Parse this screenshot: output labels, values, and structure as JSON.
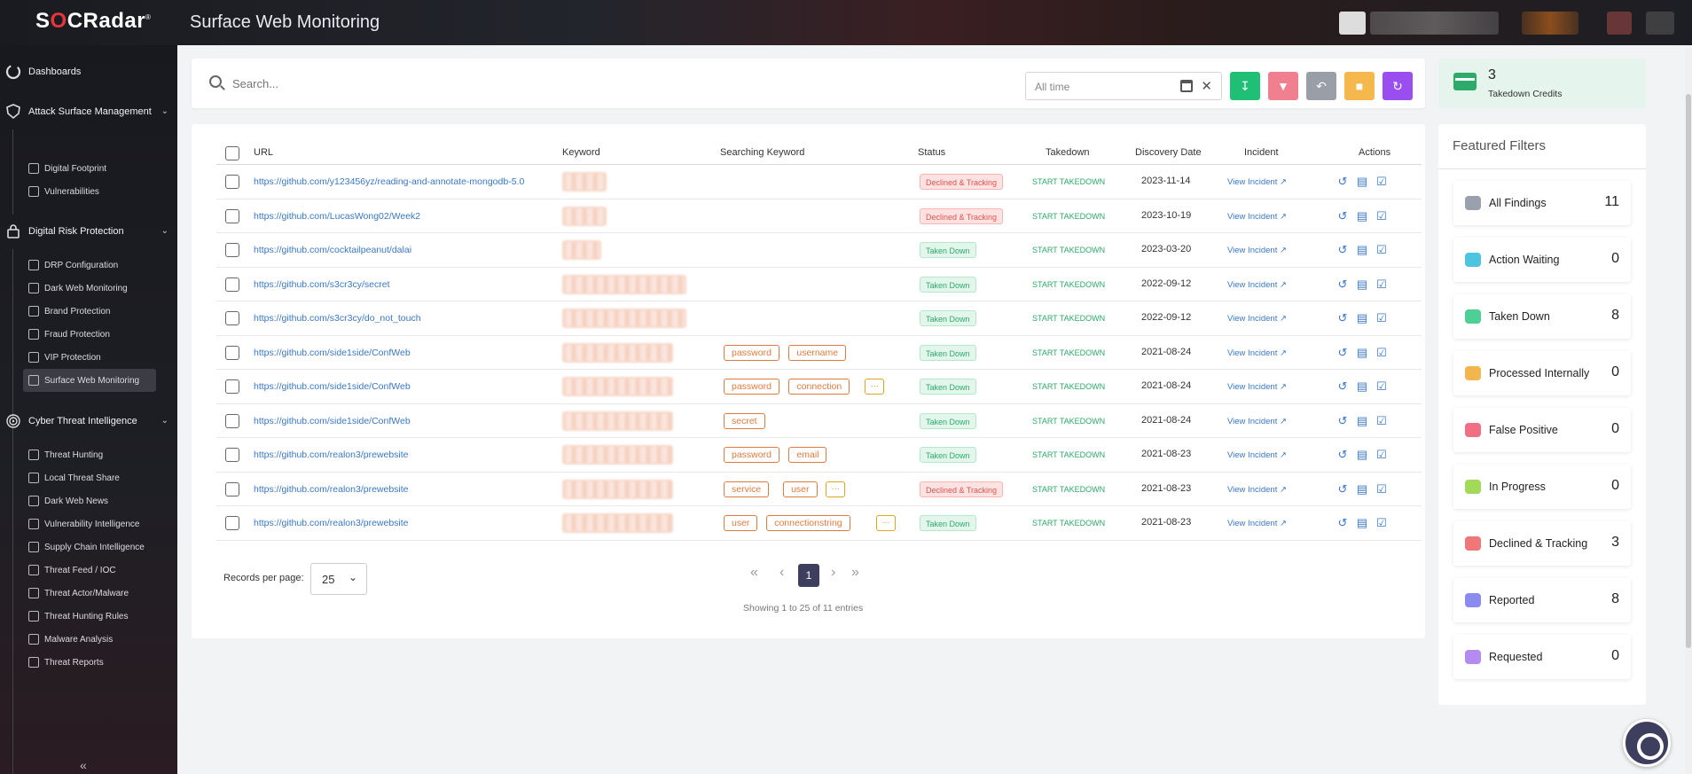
{
  "app": {
    "logo": "SOCRadar",
    "page_title": "Surface Web Monitoring"
  },
  "colors": {
    "accent": "#3a78c8",
    "success": "#2eaa6a",
    "danger": "#e0524d",
    "brand": "#e8353a"
  },
  "sidebar": {
    "top": [
      {
        "label": "Dashboards",
        "icon": "dashboard-icon"
      },
      {
        "label": "Attack Surface Management",
        "icon": "shield-icon"
      },
      {
        "label": "Digital Risk Protection",
        "icon": "lock-icon"
      },
      {
        "label": "Cyber Threat Intelligence",
        "icon": "fingerprint-icon"
      }
    ],
    "asm": [
      "Digital Footprint",
      "Vulnerabilities"
    ],
    "drp": [
      "DRP Configuration",
      "Dark Web Monitoring",
      "Brand Protection",
      "Fraud Protection",
      "VIP Protection",
      "Surface Web Monitoring"
    ],
    "cti": [
      "Threat Hunting",
      "Local Threat Share",
      "Dark Web News",
      "Vulnerability Intelligence",
      "Supply Chain Intelligence",
      "Threat Feed / IOC",
      "Threat Actor/Malware",
      "Threat Hunting Rules",
      "Malware Analysis",
      "Threat Reports"
    ]
  },
  "search": {
    "placeholder": "Search...",
    "date_range": "All time"
  },
  "toolbar": [
    "download-icon",
    "thumbs-down-icon",
    "undo-icon",
    "note-icon",
    "refresh-icon"
  ],
  "table": {
    "headers": [
      "URL",
      "Keyword",
      "Searching Keyword",
      "Status",
      "Takedown",
      "Discovery Date",
      "Incident",
      "Actions"
    ],
    "rows": [
      {
        "url": "https://github.com/y123456yz/reading-and-annotate-mongodb-5.0",
        "tags": [],
        "more": false,
        "status": "Declined & Tracking",
        "takedown": "START TAKEDOWN",
        "date": "2023-11-14",
        "incident": "View Incident"
      },
      {
        "url": "https://github.com/LucasWong02/Week2",
        "tags": [],
        "more": false,
        "status": "Declined & Tracking",
        "takedown": "START TAKEDOWN",
        "date": "2023-10-19",
        "incident": "View Incident"
      },
      {
        "url": "https://github.com/cocktailpeanut/dalai",
        "tags": [],
        "more": false,
        "status": "Taken Down",
        "takedown": "START TAKEDOWN",
        "date": "2023-03-20",
        "incident": "View Incident"
      },
      {
        "url": "https://github.com/s3cr3cy/secret",
        "tags": [],
        "more": false,
        "status": "Taken Down",
        "takedown": "START TAKEDOWN",
        "date": "2022-09-12",
        "incident": "View Incident"
      },
      {
        "url": "https://github.com/s3cr3cy/do_not_touch",
        "tags": [],
        "more": false,
        "status": "Taken Down",
        "takedown": "START TAKEDOWN",
        "date": "2022-09-12",
        "incident": "View Incident"
      },
      {
        "url": "https://github.com/side1side/ConfWeb",
        "tags": [
          "password",
          "username"
        ],
        "more": false,
        "status": "Taken Down",
        "takedown": "START TAKEDOWN",
        "date": "2021-08-24",
        "incident": "View Incident"
      },
      {
        "url": "https://github.com/side1side/ConfWeb",
        "tags": [
          "password",
          "connection"
        ],
        "more": true,
        "status": "Taken Down",
        "takedown": "START TAKEDOWN",
        "date": "2021-08-24",
        "incident": "View Incident"
      },
      {
        "url": "https://github.com/side1side/ConfWeb",
        "tags": [
          "secret"
        ],
        "more": false,
        "status": "Taken Down",
        "takedown": "START TAKEDOWN",
        "date": "2021-08-24",
        "incident": "View Incident"
      },
      {
        "url": "https://github.com/realon3/prewebsite",
        "tags": [
          "password",
          "email"
        ],
        "more": false,
        "status": "Taken Down",
        "takedown": "START TAKEDOWN",
        "date": "2021-08-23",
        "incident": "View Incident"
      },
      {
        "url": "https://github.com/realon3/prewebsite",
        "tags": [
          "service",
          "user"
        ],
        "more": true,
        "status": "Declined & Tracking",
        "takedown": "START TAKEDOWN",
        "date": "2021-08-23",
        "incident": "View Incident"
      },
      {
        "url": "https://github.com/realon3/prewebsite",
        "tags": [
          "user",
          "connectionstring"
        ],
        "more": true,
        "status": "Taken Down",
        "takedown": "START TAKEDOWN",
        "date": "2021-08-23",
        "incident": "View Incident"
      }
    ]
  },
  "pagination": {
    "records_label": "Records per page:",
    "per_page": "25",
    "current_page": "1",
    "showing": "Showing 1 to 25 of 11 entries"
  },
  "credits": {
    "count": "3",
    "label": "Takedown Credits"
  },
  "featured": {
    "title": "Featured Filters",
    "items": [
      {
        "label": "All Findings",
        "count": "11",
        "color": "#9aa0ad"
      },
      {
        "label": "Action Waiting",
        "count": "0",
        "color": "#4ec5e0"
      },
      {
        "label": "Taken Down",
        "count": "8",
        "color": "#4fcf95"
      },
      {
        "label": "Processed Internally",
        "count": "0",
        "color": "#f3b64e"
      },
      {
        "label": "False Positive",
        "count": "0",
        "color": "#f06f84"
      },
      {
        "label": "In Progress",
        "count": "0",
        "color": "#a3d95a"
      },
      {
        "label": "Declined & Tracking",
        "count": "3",
        "color": "#f07777"
      },
      {
        "label": "Reported",
        "count": "8",
        "color": "#8b8bef"
      },
      {
        "label": "Requested",
        "count": "0",
        "color": "#b48cf0"
      }
    ]
  }
}
